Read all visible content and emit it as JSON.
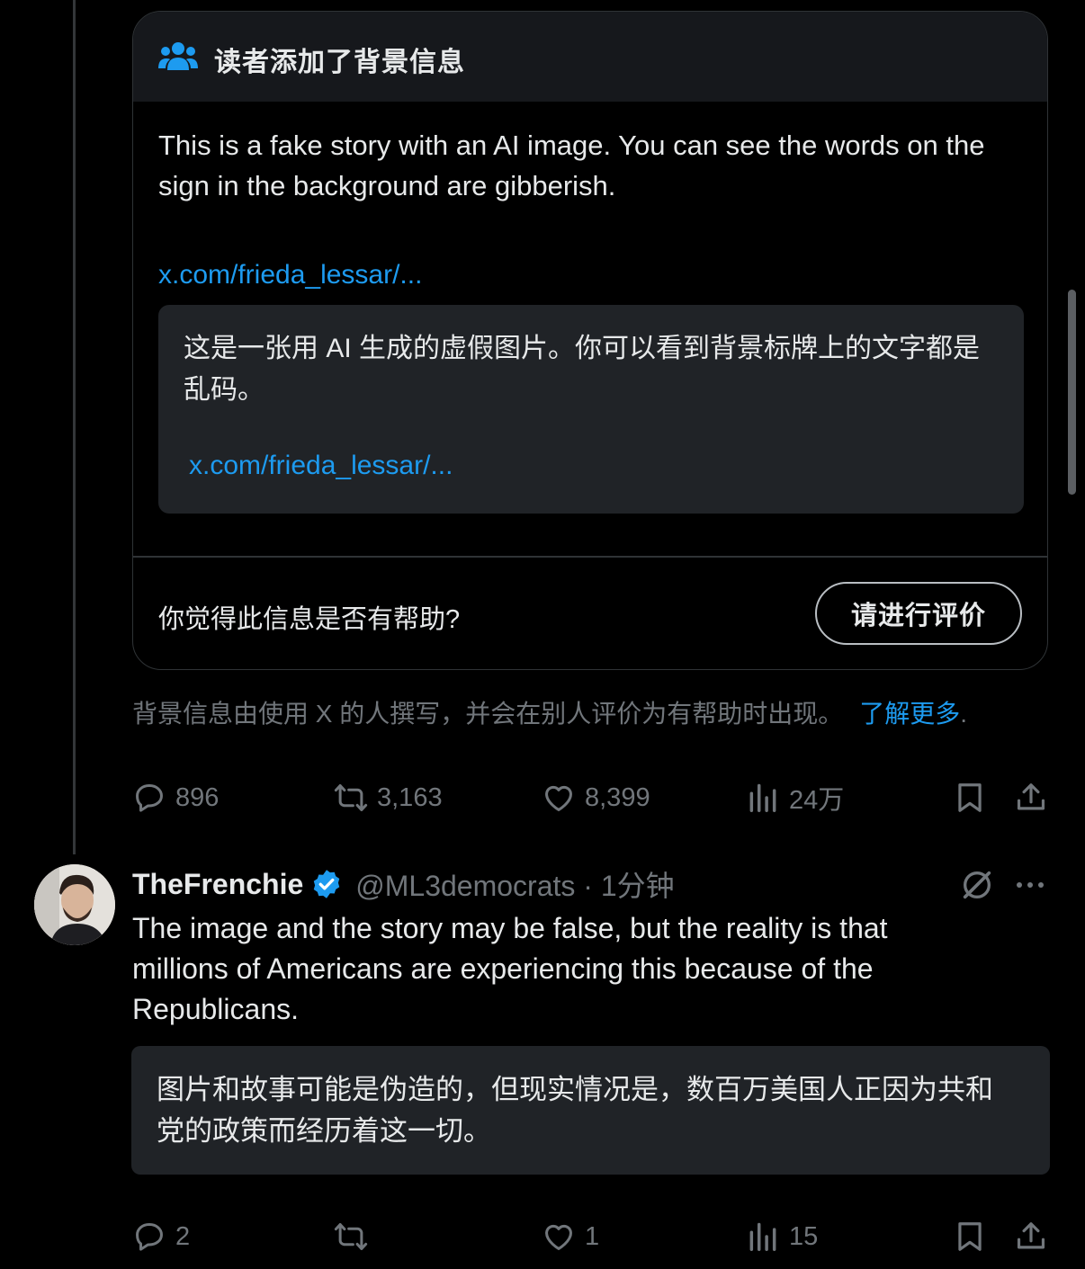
{
  "community_note": {
    "header_title": "读者添加了背景信息",
    "header_icon": "people-icon",
    "body": "This is a fake story with an AI image. You can see the words on the sign in the background are gibberish.",
    "link": "x.com/frieda_lessar/...",
    "translation": {
      "text": "这是一张用 AI 生成的虚假图片。你可以看到背景标牌上的文字都是乱码。",
      "link": "x.com/frieda_lessar/..."
    },
    "helpful_question": "你觉得此信息是否有帮助?",
    "rate_button": "请进行评价",
    "footer_text": "背景信息由使用 X 的人撰写，并会在别人评价为有帮助时出现。",
    "footer_link": "了解更多",
    "footer_period": "."
  },
  "main_actions": {
    "replies": "896",
    "reposts": "3,163",
    "likes": "8,399",
    "views": "24万"
  },
  "reply": {
    "name": "TheFrenchie",
    "handle_time": "@ML3democrats · 1分钟",
    "text": "The image and the story may be false, but the reality is that millions of Americans are experiencing this because of the Republicans.",
    "translation": "图片和故事可能是伪造的，但现实情况是，数百万美国人正因为共和党的政策而经历着这一切。",
    "actions": {
      "replies": "2",
      "reposts": "",
      "likes": "1",
      "views": "15"
    }
  },
  "colors": {
    "accent": "#1d9bf0",
    "muted": "#71767b",
    "text": "#e7e9ea",
    "background": "#000000",
    "card_header": "#16181c",
    "translate_bg": "#202327"
  }
}
